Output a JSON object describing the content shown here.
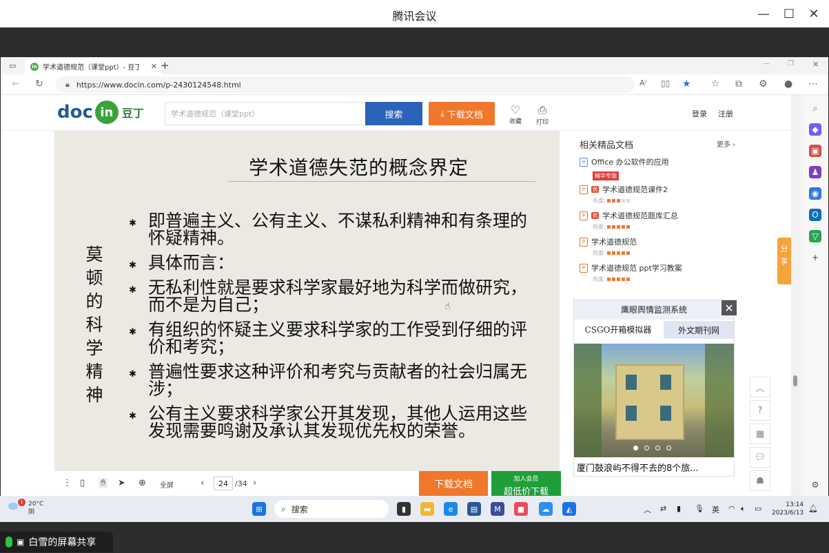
{
  "meeting": {
    "title": "腾讯会议",
    "share_label": "白雪的屏幕共享"
  },
  "browser": {
    "tab_title": "学术道德规范（课堂ppt）- 豆丁网",
    "url": "https://www.docin.com/p-2430124548.html"
  },
  "site": {
    "logo_left": "doc",
    "logo_in": "in",
    "logo_cn": "豆丁",
    "search_placeholder": "学术道德规范（课堂ppt）",
    "search_button": "搜索",
    "download_button": "下载文档",
    "favorite_label": "收藏",
    "print_label": "打印",
    "login": "登录",
    "register": "注册"
  },
  "slide": {
    "title": "学术道德失范的概念界定",
    "side_text": "莫顿的科学精神",
    "bullets": [
      "即普遍主义、公有主义、不谋私利精神和有条理的怀疑精神。",
      "具体而言：",
      "无私利性就是要求科学家最好地为科学而做研究，而不是为自己；",
      "有组织的怀疑主义要求科学家的工作受到仔细的评价和考究；",
      "普遍性要求这种评价和考究与贡献者的社会归属无涉；",
      "公有主义要求科学家公开其发现，其他人运用这些发现需要鸣谢及承认其发现优先权的荣誉。"
    ]
  },
  "viewer": {
    "fullscreen": "全屏",
    "page_current": "24",
    "page_total": "/34",
    "download": "下载文档",
    "vip_small": "加入会员",
    "vip_big": "超低价下载"
  },
  "related": {
    "title": "相关精品文档",
    "more": "更多",
    "heat_label": "热度:",
    "items": [
      {
        "title": "Office 办公软件的应用",
        "tag": "精华专题"
      },
      {
        "title": "学术道德规范课件2"
      },
      {
        "title": "学术道德规范题库汇总"
      },
      {
        "title": "学术道德规范"
      },
      {
        "title": "学术道德规范 ppt学习教案"
      }
    ]
  },
  "ad": {
    "title": "鹰眼舆情监测系统",
    "tab1": "CSGO开箱模拟器",
    "tab2": "外文期刊网",
    "caption": "厦门鼓浪屿不得不去的8个旅..."
  },
  "share_tab": "分享",
  "taskbar": {
    "weather_temp": "20°C",
    "weather_desc": "阴",
    "weather_badge": "1",
    "search": "搜索",
    "lang": "英",
    "time": "13:14",
    "date": "2023/6/13"
  }
}
